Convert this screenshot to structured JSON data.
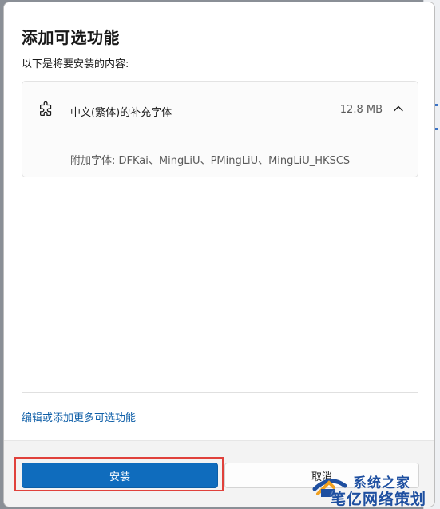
{
  "dialog": {
    "title": "添加可选功能",
    "subtitle": "以下是将要安装的内容:"
  },
  "feature": {
    "icon": "puzzle-icon",
    "name": "中文(繁体)的补充字体",
    "size": "12.8 MB",
    "detail": "附加字体: DFKai、MingLiU、PMingLiU、MingLiU_HKSCS",
    "expanded": true
  },
  "links": {
    "more": "编辑或添加更多可选功能"
  },
  "footer": {
    "install_label": "安装",
    "cancel_label": "取消"
  },
  "watermark": {
    "line1": "系统之家",
    "line2": "笔亿网络策划"
  },
  "colors": {
    "accent": "#0f6cbd",
    "link": "#0f5fa8",
    "highlight": "#e0413b"
  }
}
